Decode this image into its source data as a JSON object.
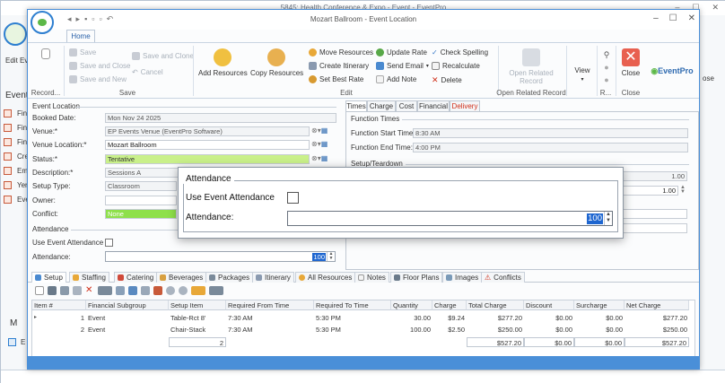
{
  "background_window": {
    "title": "5845: Health Conference & Expo - Event - EventPro",
    "left_items": [
      "Edit Ev",
      "Event",
      "Fin",
      "Fin",
      "Fin",
      "Cre",
      "Em",
      "Yer",
      "Eve",
      "M",
      "E"
    ],
    "right_items": [
      "ose"
    ]
  },
  "window": {
    "title": "Mozart Ballroom - Event Location",
    "controls": [
      "–",
      "☐",
      "✕"
    ]
  },
  "ribbon": {
    "tab_home": "Home",
    "record_label": "Record...",
    "save": {
      "save": "Save",
      "save_and_close": "Save and Close",
      "save_and_new": "Save and New",
      "save_and_clone": "Save and Clone",
      "cancel": "Cancel",
      "group": "Save"
    },
    "edit": {
      "add_resources": "Add Resources",
      "copy_resources": "Copy Resources",
      "move_resources": "Move Resources",
      "create_itinerary": "Create Itinerary",
      "set_best_rate": "Set Best Rate",
      "update_rate": "Update Rate",
      "send_email": "Send Email",
      "add_note": "Add Note",
      "check_spelling": "Check Spelling",
      "recalculate": "Recalculate",
      "delete": "Delete",
      "group": "Edit"
    },
    "open_related_record": "Open Related Record",
    "open_related_group": "Open Related Record",
    "view": "View",
    "r_group": "R...",
    "close": "Close",
    "close_group": "Close",
    "brand": "EventPro"
  },
  "event_location": {
    "section_title": "Event Location",
    "booked_date_label": "Booked Date:",
    "booked_date": "Mon Nov 24 2025",
    "venue_label": "Venue:*",
    "venue": "EP Events Venue (EventPro Software)",
    "venue_location_label": "Venue Location:*",
    "venue_location": "Mozart Ballroom",
    "status_label": "Status:*",
    "status": "Tentative",
    "description_label": "Description:*",
    "description": "Sessions A",
    "setup_type_label": "Setup Type:",
    "setup_type": "Classroom",
    "owner_label": "Owner:",
    "owner": "",
    "conflict_label": "Conflict:",
    "conflict": "None"
  },
  "attendance": {
    "section_title": "Attendance",
    "use_label": "Use Event Attendance",
    "attendance_label": "Attendance:",
    "attendance_value": "100"
  },
  "right_panel": {
    "tabs": [
      "Times",
      "Charge",
      "Cost",
      "Financial",
      "Delivery"
    ],
    "function_times_title": "Function Times",
    "start_label": "Function Start Time:",
    "start_value": "8:30 AM",
    "end_label": "Function End Time:",
    "end_value": "4:00 PM",
    "setup_teardown_title": "Setup/Teardown",
    "value_1": "1.00",
    "value_2": "1.00"
  },
  "bottom_tabs": [
    "Setup",
    "Staffing",
    "Catering",
    "Beverages",
    "Packages",
    "Itinerary",
    "All Resources",
    "Notes",
    "Floor Plans",
    "Images",
    "Conflicts"
  ],
  "grid": {
    "columns": [
      "Item #",
      "Financial Subgroup",
      "Setup Item",
      "Required From Time",
      "Required To Time",
      "Quantity",
      "Charge",
      "Total Charge",
      "Discount",
      "Surcharge",
      "Net Charge"
    ],
    "rows": [
      [
        "1",
        "Event",
        "Table-Rct 8'",
        "7:30 AM",
        "5:30 PM",
        "30.00",
        "$9.24",
        "$277.20",
        "$0.00",
        "$0.00",
        "$277.20"
      ],
      [
        "2",
        "Event",
        "Chair-Stack",
        "7:30 AM",
        "5:30 PM",
        "100.00",
        "$2.50",
        "$250.00",
        "$0.00",
        "$0.00",
        "$250.00"
      ]
    ],
    "totals": {
      "count": "2",
      "total_charge": "$527.20",
      "discount": "$0.00",
      "surcharge": "$0.00",
      "net_charge": "$527.20"
    }
  },
  "popup": {
    "title": "Attendance",
    "use_label": "Use Event Attendance",
    "attendance_label": "Attendance:",
    "value": "100"
  }
}
